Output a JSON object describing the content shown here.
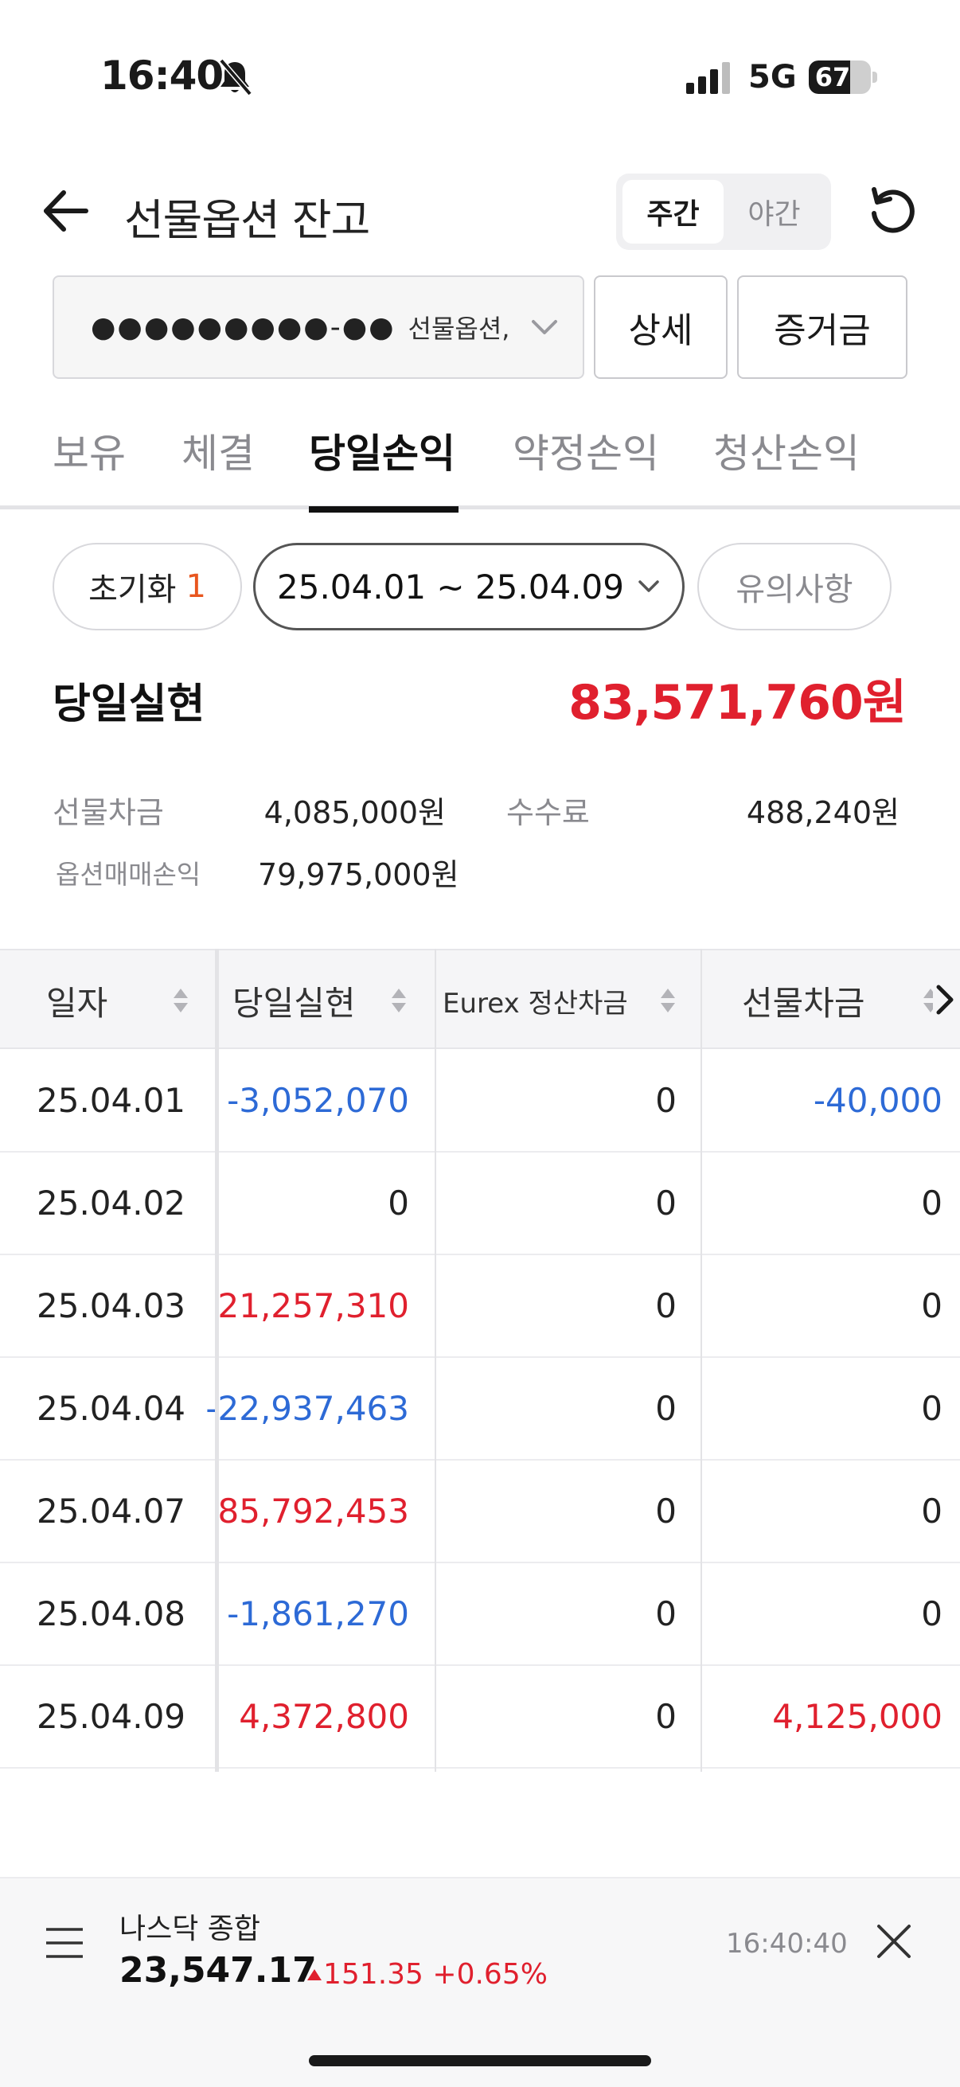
{
  "status_bar": {
    "time": "16:40",
    "network": "5G",
    "battery": "67",
    "battery_level": 0.67
  },
  "header": {
    "title": "선물옵션 잔고",
    "session_tabs": [
      {
        "label": "주간",
        "active": true
      },
      {
        "label": "야간",
        "active": false
      }
    ]
  },
  "account": {
    "masked_number": "●●●●●●●●●-●●",
    "type": "선물옵션,",
    "detail_button": "상세",
    "margin_button": "증거금"
  },
  "tabs": [
    {
      "label": "보유",
      "active": false
    },
    {
      "label": "체결",
      "active": false
    },
    {
      "label": "당일손익",
      "active": true
    },
    {
      "label": "약정손익",
      "active": false
    },
    {
      "label": "청산손익",
      "active": false
    }
  ],
  "filters": {
    "reset_label": "초기화",
    "reset_count": "1",
    "date_range": "25.04.01 ~ 25.04.09",
    "notice_label": "유의사항"
  },
  "summary": {
    "label": "당일실현",
    "value": "83,571,760원",
    "futures_diff_label": "선물차금",
    "futures_diff_value": "4,085,000원",
    "fee_label": "수수료",
    "fee_value": "488,240원",
    "option_pnl_label": "옵션매매손익",
    "option_pnl_value": "79,975,000원"
  },
  "table": {
    "headers": [
      "일자",
      "당일실현",
      "Eurex 정산차금",
      "선물차금"
    ],
    "rows": [
      {
        "date": "25.04.01",
        "realized": "-3,052,070",
        "realized_sign": "neg",
        "eurex": "0",
        "futures": "-40,000",
        "futures_sign": "neg"
      },
      {
        "date": "25.04.02",
        "realized": "0",
        "realized_sign": "zero",
        "eurex": "0",
        "futures": "0",
        "futures_sign": "zero"
      },
      {
        "date": "25.04.03",
        "realized": "21,257,310",
        "realized_sign": "pos",
        "eurex": "0",
        "futures": "0",
        "futures_sign": "zero"
      },
      {
        "date": "25.04.04",
        "realized": "-22,937,463",
        "realized_sign": "neg",
        "eurex": "0",
        "futures": "0",
        "futures_sign": "zero"
      },
      {
        "date": "25.04.07",
        "realized": "85,792,453",
        "realized_sign": "pos",
        "eurex": "0",
        "futures": "0",
        "futures_sign": "zero"
      },
      {
        "date": "25.04.08",
        "realized": "-1,861,270",
        "realized_sign": "neg",
        "eurex": "0",
        "futures": "0",
        "futures_sign": "zero"
      },
      {
        "date": "25.04.09",
        "realized": "4,372,800",
        "realized_sign": "pos",
        "eurex": "0",
        "futures": "4,125,000",
        "futures_sign": "pos"
      }
    ]
  },
  "ticker": {
    "name": "나스닥 종합",
    "price": "23,547.17",
    "change": "151.35 +0.65%",
    "time": "16:40:40"
  },
  "colors": {
    "positive": "#e0202e",
    "negative": "#2d6ad6",
    "accent_count": "#e8561f"
  },
  "icons": [
    "bell-off-icon",
    "signal-icon",
    "back-arrow-icon",
    "refresh-icon",
    "chevron-down-icon",
    "sort-icon",
    "chevron-right-icon",
    "menu-icon",
    "close-icon",
    "triangle-up-icon"
  ]
}
